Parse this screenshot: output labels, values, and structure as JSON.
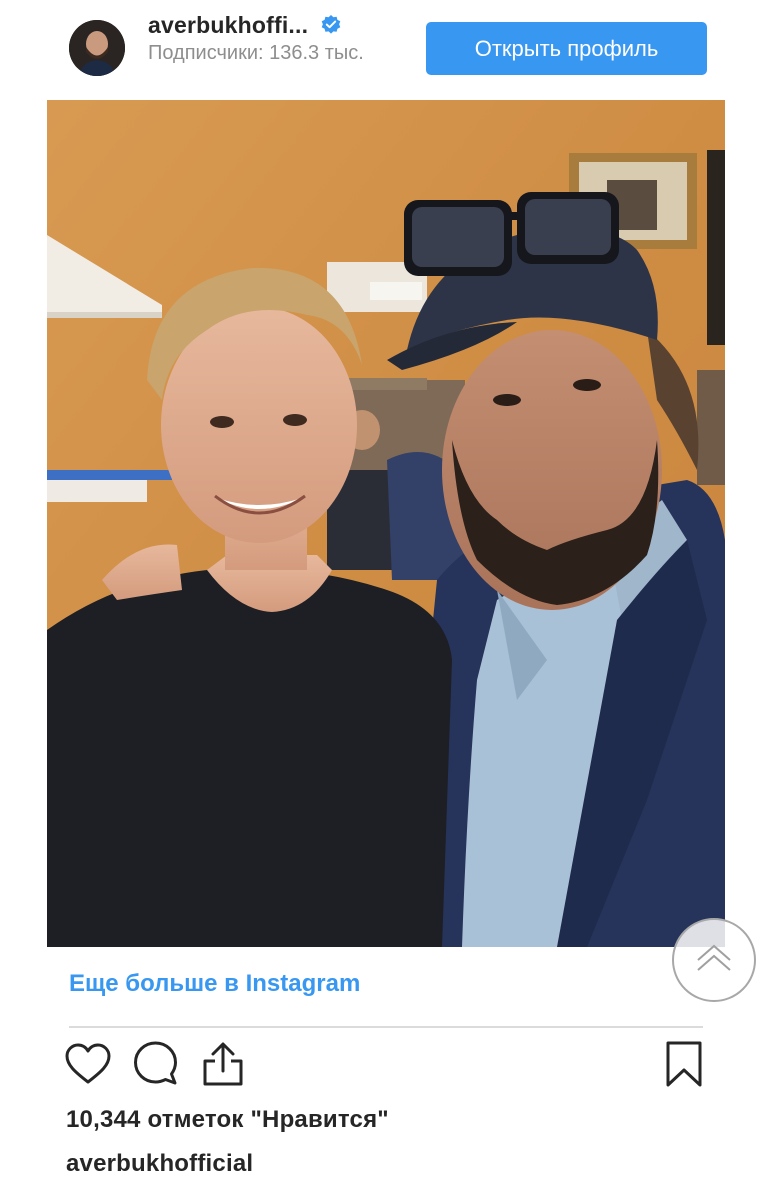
{
  "profile": {
    "username": "averbukhoffi...",
    "followers_text": "Подписчики: 136.3 тыс.",
    "verified": true,
    "open_profile_label": "Открыть профиль"
  },
  "post": {
    "more_link": "Еще больше в Instagram",
    "likes_text": "10,344 отметок \"Нравится\"",
    "caption_username": "averbukhofficial"
  },
  "icons": {
    "like": "heart-icon",
    "comment": "comment-icon",
    "share": "share-icon",
    "save": "bookmark-icon",
    "scroll_top": "chevrons-up-icon",
    "verified": "verified-badge-icon"
  },
  "colors": {
    "accent": "#3897f0",
    "text": "#262626",
    "muted": "#8e8e8e",
    "divider": "#dbdbdb"
  }
}
